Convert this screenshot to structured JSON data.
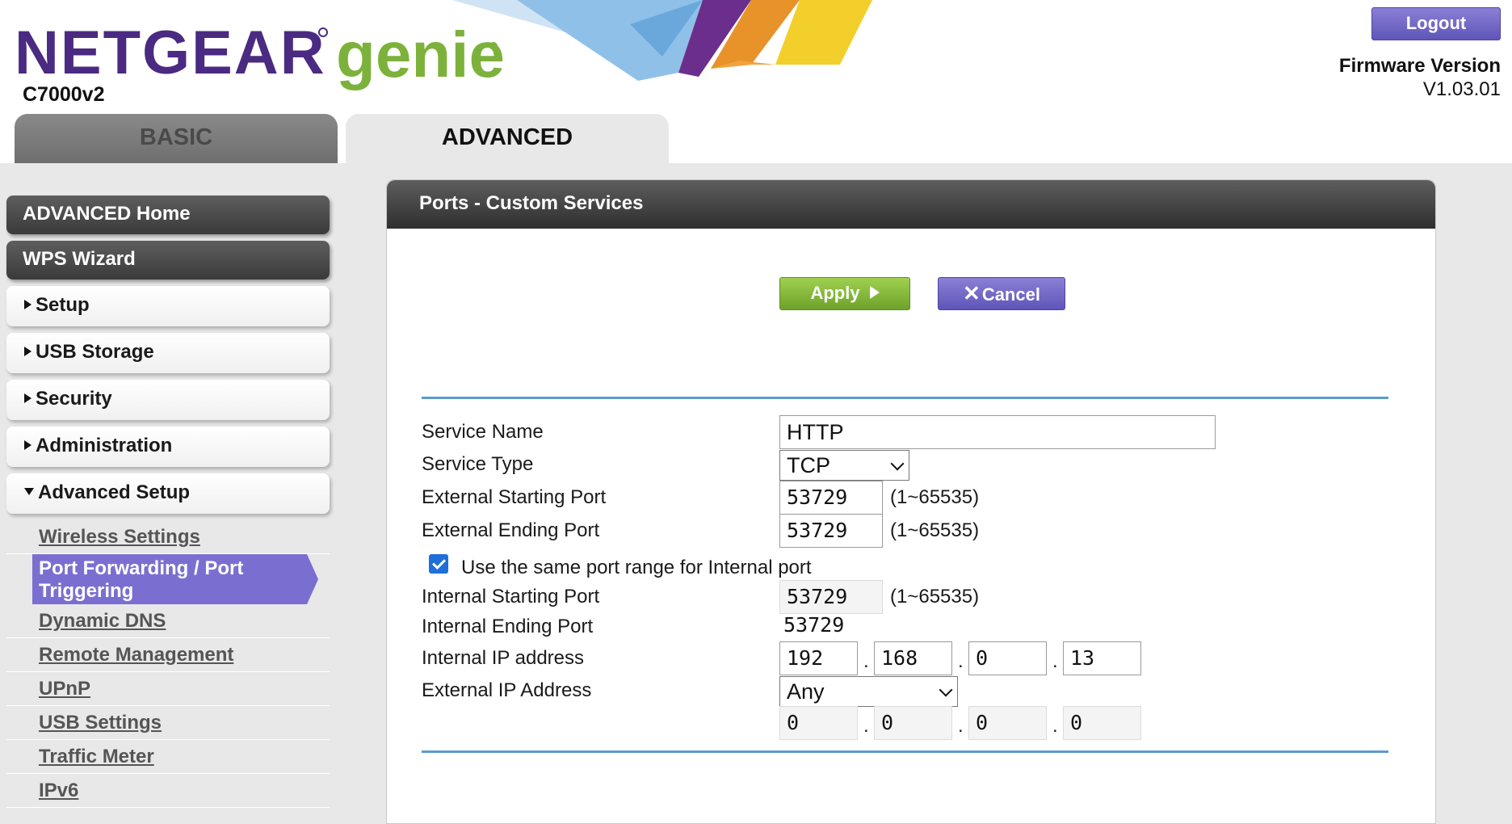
{
  "header": {
    "brand_primary": "NETGEAR",
    "brand_secondary": "genie",
    "model": "C7000v2",
    "logout_label": "Logout",
    "firmware_label": "Firmware Version",
    "firmware_value": "V1.03.01"
  },
  "tabs": [
    {
      "label": "BASIC",
      "active": false
    },
    {
      "label": "ADVANCED",
      "active": true
    }
  ],
  "sidebar": {
    "main_items": [
      "ADVANCED Home",
      "WPS Wizard"
    ],
    "menus": [
      {
        "label": "Setup",
        "expanded": false
      },
      {
        "label": "USB Storage",
        "expanded": false
      },
      {
        "label": "Security",
        "expanded": false
      },
      {
        "label": "Administration",
        "expanded": false
      },
      {
        "label": "Advanced Setup",
        "expanded": true
      }
    ],
    "submenu": {
      "before_active": [
        "Wireless Settings"
      ],
      "active": "Port Forwarding / Port Triggering",
      "after_active": [
        "Dynamic DNS",
        "Remote Management",
        "UPnP",
        "USB Settings",
        "Traffic Meter",
        "IPv6"
      ]
    }
  },
  "panel": {
    "title": "Ports - Custom Services",
    "apply_label": "Apply",
    "cancel_label": "Cancel",
    "form": {
      "service_name_label": "Service Name",
      "service_name_value": "HTTP",
      "service_type_label": "Service Type",
      "service_type_value": "TCP",
      "ext_start_label": "External Starting Port",
      "ext_start_value": "53729",
      "ext_end_label": "External Ending Port",
      "ext_end_value": "53729",
      "range_hint": "(1~65535)",
      "same_range_label": "Use the same port range for Internal port",
      "same_range_checked": true,
      "int_start_label": "Internal Starting Port",
      "int_start_value": "53729",
      "int_end_label": "Internal Ending Port",
      "int_end_value": "53729",
      "int_ip_label": "Internal IP address",
      "int_ip": [
        "192",
        "168",
        "0",
        "13"
      ],
      "ext_ip_label": "External IP Address",
      "ext_ip_select": "Any",
      "ext_ip": [
        "0",
        "0",
        "0",
        "0"
      ]
    }
  },
  "colors": {
    "brand_purple": "#4b2a82",
    "brand_green": "#7cb23b",
    "accent_purple": "#7a6fd1",
    "apply_green": "#8cc43f",
    "rule_blue": "#5b9bd1"
  }
}
